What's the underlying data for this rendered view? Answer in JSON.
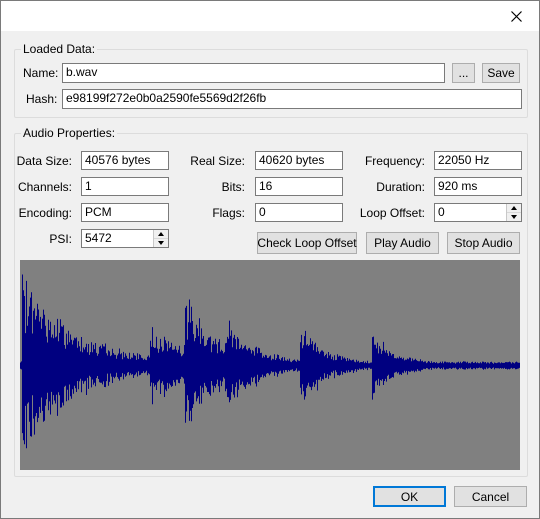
{
  "window": {
    "close_glyph": "✕"
  },
  "loaded": {
    "title": "Loaded Data:",
    "name_label": "Name:",
    "name_value": "b.wav",
    "browse_label": "...",
    "save_label": "Save",
    "hash_label": "Hash:",
    "hash_value": "e98199f272e0b0a2590fe5569d2f26fb"
  },
  "audio": {
    "title": "Audio Properties:",
    "data_size_label": "Data Size:",
    "data_size": "40576 bytes",
    "real_size_label": "Real Size:",
    "real_size": "40620 bytes",
    "frequency_label": "Frequency:",
    "frequency": "22050 Hz",
    "channels_label": "Channels:",
    "channels": "1",
    "bits_label": "Bits:",
    "bits": "16",
    "duration_label": "Duration:",
    "duration": "920 ms",
    "encoding_label": "Encoding:",
    "encoding": "PCM",
    "flags_label": "Flags:",
    "flags": "0",
    "loop_offset_label": "Loop Offset:",
    "loop_offset": "0",
    "psi_label": "PSI:",
    "psi": "5472",
    "check_loop_label": "Check Loop Offset",
    "play_label": "Play Audio",
    "stop_label": "Stop Audio"
  },
  "waveform": {
    "background": "#808080",
    "wave_color": "#000080"
  },
  "footer": {
    "ok_label": "OK",
    "cancel_label": "Cancel"
  }
}
